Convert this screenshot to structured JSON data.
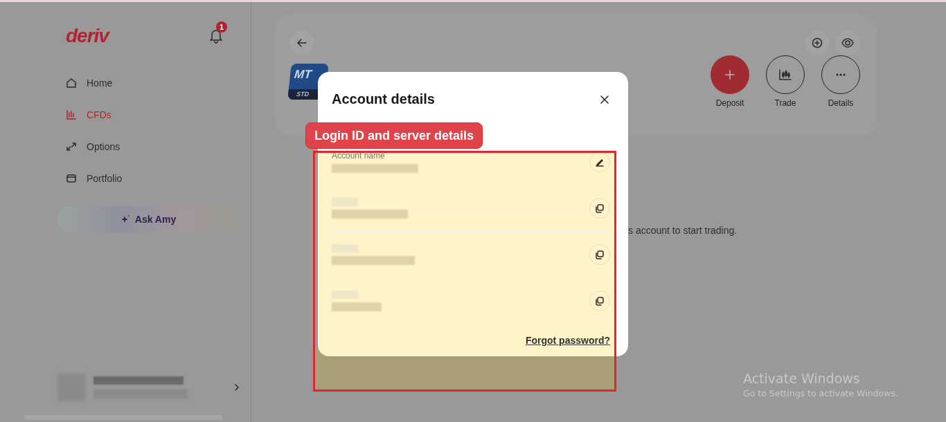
{
  "sidebar": {
    "logo": "deriv",
    "notification_count": "1",
    "nav": [
      {
        "label": "Home",
        "kind": "home",
        "selected": false
      },
      {
        "label": "CFDs",
        "kind": "chart",
        "selected": true
      },
      {
        "label": "Options",
        "kind": "options",
        "selected": false
      },
      {
        "label": "Portfolio",
        "kind": "wallet",
        "selected": false
      }
    ],
    "ask_button": "Ask Amy"
  },
  "main": {
    "account_logo": {
      "title": "MT",
      "subtitle": "STD"
    },
    "actions": [
      {
        "label": "Deposit",
        "kind": "primary"
      },
      {
        "label": "Trade",
        "kind": "trade"
      },
      {
        "label": "Details",
        "kind": "more"
      }
    ],
    "message": "s account to start trading."
  },
  "modal": {
    "title": "Account details",
    "rows": [
      {
        "label": "Account name",
        "kind": "edit"
      },
      {
        "kind": "copy"
      },
      {
        "kind": "copy"
      },
      {
        "kind": "copy"
      }
    ],
    "link": "Forgot password?"
  },
  "annotation": {
    "label": "Login ID and server details"
  },
  "os_watermark": {
    "title": "Activate Windows",
    "subtitle": "Go to Settings to activate Windows."
  }
}
